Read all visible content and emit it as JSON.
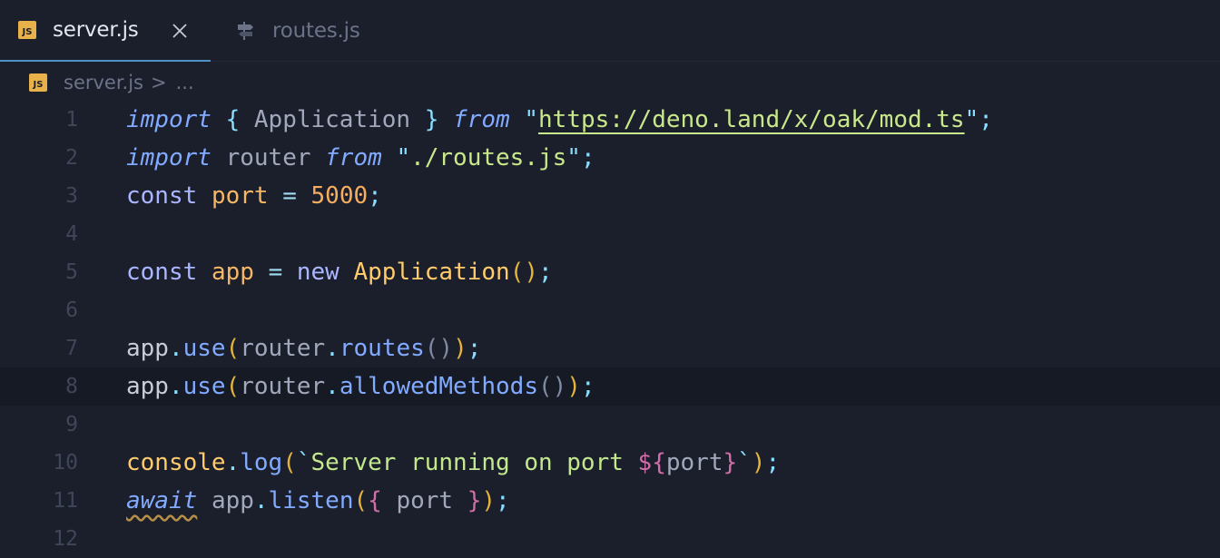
{
  "tabs": [
    {
      "label": "server.js",
      "icon": "js-file-icon",
      "active": true
    },
    {
      "label": "routes.js",
      "icon": "route-icon",
      "active": false
    }
  ],
  "breadcrumb": {
    "file": "server.js",
    "separator": ">",
    "ellipsis": "..."
  },
  "editor": {
    "current_line": 8,
    "lines": [
      {
        "num": "1",
        "text": "import { Application } from \"https://deno.land/x/oak/mod.ts\";"
      },
      {
        "num": "2",
        "text": "import router from \"./routes.js\";"
      },
      {
        "num": "3",
        "text": "const port = 5000;"
      },
      {
        "num": "4",
        "text": ""
      },
      {
        "num": "5",
        "text": "const app = new Application();"
      },
      {
        "num": "6",
        "text": ""
      },
      {
        "num": "7",
        "text": "app.use(router.routes());"
      },
      {
        "num": "8",
        "text": "app.use(router.allowedMethods());"
      },
      {
        "num": "9",
        "text": ""
      },
      {
        "num": "10",
        "text": "console.log(`Server running on port ${port}`);"
      },
      {
        "num": "11",
        "text": "await app.listen({ port });"
      },
      {
        "num": "12",
        "text": ""
      }
    ]
  },
  "colors": {
    "background": "#1b1f2b",
    "keyword": "#82aaff",
    "string": "#c9e88b",
    "number": "#f7ad60",
    "active_tab_border": "#4f93c8"
  }
}
